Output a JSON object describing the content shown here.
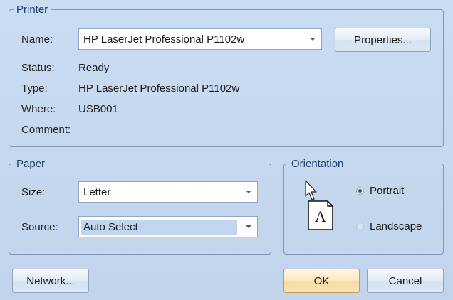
{
  "printer": {
    "legend": "Printer",
    "name_label": "Name:",
    "name_value": "HP LaserJet Professional P1102w",
    "properties_button": "Properties...",
    "status_label": "Status:",
    "status_value": "Ready",
    "type_label": "Type:",
    "type_value": "HP LaserJet Professional P1102w",
    "where_label": "Where:",
    "where_value": "USB001",
    "comment_label": "Comment:",
    "comment_value": ""
  },
  "paper": {
    "legend": "Paper",
    "size_label": "Size:",
    "size_value": "Letter",
    "source_label": "Source:",
    "source_value": "Auto Select"
  },
  "orientation": {
    "legend": "Orientation",
    "page_glyph": "A",
    "portrait_label": "Portrait",
    "landscape_label": "Landscape",
    "selected": "portrait"
  },
  "buttons": {
    "network": "Network...",
    "ok": "OK",
    "cancel": "Cancel"
  },
  "icons": {
    "dropdown": "chevron-down-icon",
    "page": "page-portrait-icon",
    "cursor": "mouse-cursor-icon"
  }
}
